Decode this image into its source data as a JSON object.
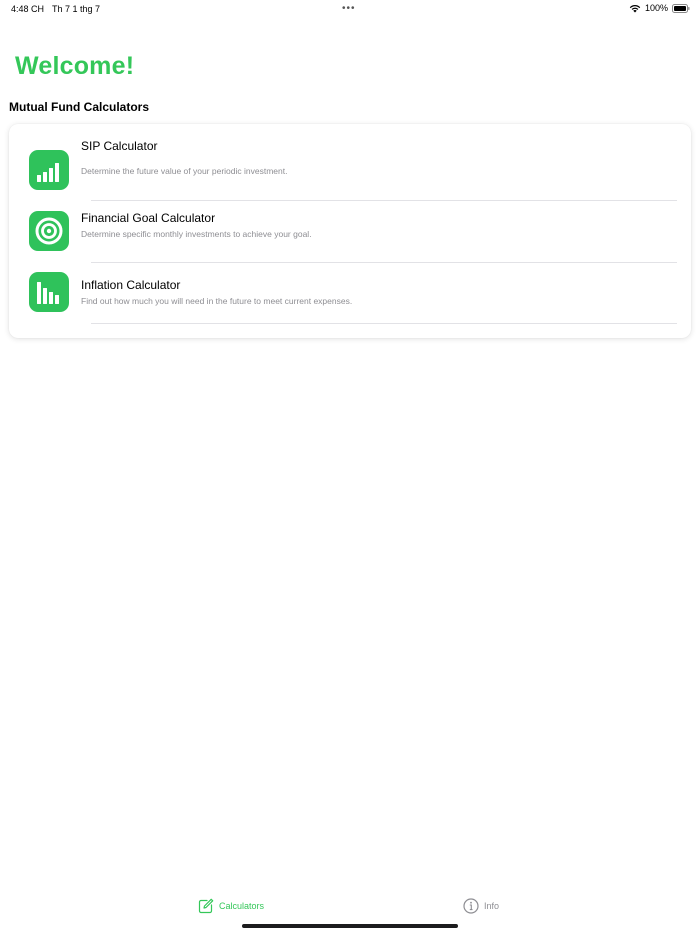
{
  "status_bar": {
    "time": "4:48 CH",
    "date": "Th 7 1 thg 7",
    "dots": "•••",
    "battery": "100%"
  },
  "header": {
    "title": "Welcome!",
    "section": "Mutual Fund Calculators"
  },
  "calculators": [
    {
      "title": "SIP Calculator",
      "description": "Determine the future value of your periodic investment.",
      "icon": "bar-chart-rising-icon"
    },
    {
      "title": "Financial Goal Calculator",
      "description": "Determine specific monthly investments to achieve your goal.",
      "icon": "target-icon"
    },
    {
      "title": "Inflation Calculator",
      "description": "Find out how much you will need in the future to meet current expenses.",
      "icon": "bar-chart-falling-icon"
    }
  ],
  "tab_bar": {
    "tabs": [
      {
        "label": "Calculators",
        "icon": "edit-icon",
        "selected": true
      },
      {
        "label": "Info",
        "icon": "info-icon",
        "selected": false
      }
    ]
  },
  "colors": {
    "accent": "#34c759",
    "icon_bg": "#2fc25b",
    "secondary_text": "#8e8e93"
  }
}
